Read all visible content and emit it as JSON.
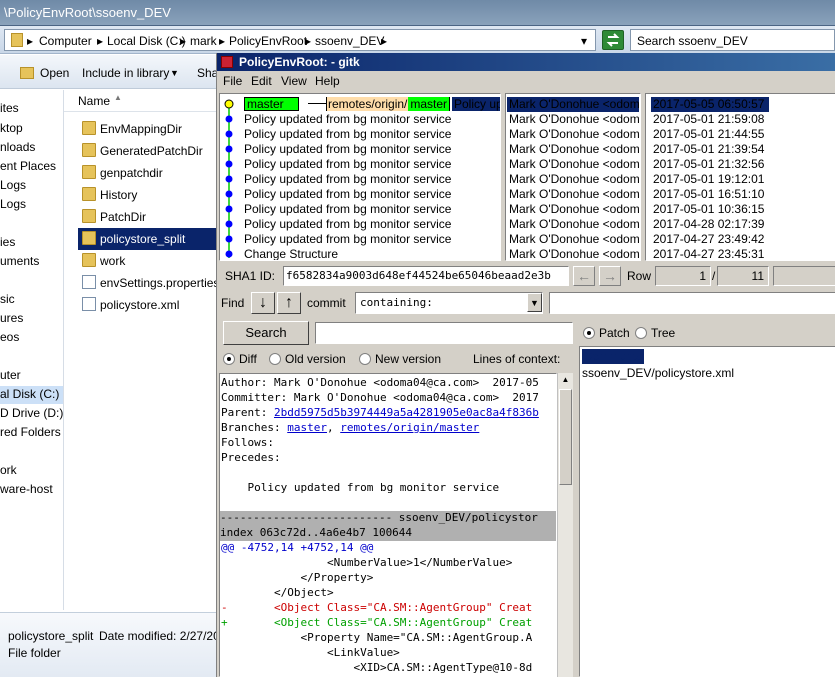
{
  "explorer": {
    "title": "\\PolicyEnvRoot\\ssoenv_DEV",
    "breadcrumbs": [
      "Computer",
      "Local Disk (C:)",
      "mark",
      "PolicyEnvRoot",
      "ssoenv_DEV"
    ],
    "search_placeholder": "Search ssoenv_DEV",
    "toolbar": {
      "open": "Open",
      "include": "Include in library",
      "share": "Sha"
    },
    "nav_items": [
      "ites",
      "ktop",
      "nloads",
      "ent Places",
      "Logs",
      "Logs",
      "ies",
      "uments",
      "sic",
      "ures",
      "eos",
      "uter",
      "al Disk (C:)",
      "D Drive (D:) E",
      "red Folders (",
      "ork",
      "ware-host"
    ],
    "column_name": "Name",
    "files": [
      {
        "name": "EnvMappingDir",
        "type": "folder"
      },
      {
        "name": "GeneratedPatchDir",
        "type": "folder"
      },
      {
        "name": "genpatchdir",
        "type": "folder"
      },
      {
        "name": "History",
        "type": "folder"
      },
      {
        "name": "PatchDir",
        "type": "folder"
      },
      {
        "name": "policystore_split",
        "type": "folder"
      },
      {
        "name": "work",
        "type": "folder"
      },
      {
        "name": "envSettings.properties",
        "type": "file"
      },
      {
        "name": "policystore.xml",
        "type": "file"
      }
    ],
    "details": {
      "name": "policystore_split",
      "modified": "Date modified: 2/27/20",
      "kind": "File folder"
    }
  },
  "gitk": {
    "title": "PolicyEnvRoot: - gitk",
    "menu": [
      "File",
      "Edit",
      "View",
      "Help"
    ],
    "branch_tags": {
      "local": "master",
      "remote_prefix": "remotes/origin/",
      "remote_branch": "master"
    },
    "commits": [
      {
        "msg": "Policy updated from bg monitor service",
        "author": "Mark O'Donohue <odoma",
        "date": "2017-05-05 06:50:57"
      },
      {
        "msg": "Policy updated from bg monitor service",
        "author": "Mark O'Donohue <odom",
        "date": "2017-05-01 21:59:08"
      },
      {
        "msg": "Policy updated from bg monitor service",
        "author": "Mark O'Donohue <odom",
        "date": "2017-05-01 21:44:55"
      },
      {
        "msg": "Policy updated from bg monitor service",
        "author": "Mark O'Donohue <odom",
        "date": "2017-05-01 21:39:54"
      },
      {
        "msg": "Policy updated from bg monitor service",
        "author": "Mark O'Donohue <odom",
        "date": "2017-05-01 21:32:56"
      },
      {
        "msg": "Policy updated from bg monitor service",
        "author": "Mark O'Donohue <odom",
        "date": "2017-05-01 19:12:01"
      },
      {
        "msg": "Policy updated from bg monitor service",
        "author": "Mark O'Donohue <odom",
        "date": "2017-05-01 16:51:10"
      },
      {
        "msg": "Policy updated from bg monitor service",
        "author": "Mark O'Donohue <odom",
        "date": "2017-05-01 10:36:15"
      },
      {
        "msg": "Policy updated from bg monitor service",
        "author": "Mark O'Donohue <odom",
        "date": "2017-04-28 02:17:39"
      },
      {
        "msg": "Policy updated from bg monitor service",
        "author": "Mark O'Donohue <odom",
        "date": "2017-04-27 23:49:42"
      },
      {
        "msg": "Change Structure",
        "author": "Mark O'Donohue <odom",
        "date": "2017-04-27 23:45:31"
      }
    ],
    "first_row_msg_clip": "Policy up",
    "sha": {
      "label": "SHA1 ID:",
      "value": "f6582834a9003d648ef44524be65046beaad2e3b",
      "row_label": "Row",
      "row": "1",
      "of": "/",
      "total": "11"
    },
    "find": {
      "label": "Find",
      "commit_label": "commit",
      "containing": "containing:"
    },
    "search": {
      "button": "Search"
    },
    "view_opts": {
      "patch": "Patch",
      "tree": "Tree",
      "diff": "Diff",
      "old": "Old version",
      "new": "New version",
      "context": "Lines of context:"
    },
    "diff_lines": [
      {
        "text": "Author: Mark O'Donohue <odoma04@ca.com>  2017-05",
        "kind": "plain"
      },
      {
        "text": "Committer: Mark O'Donohue <odoma04@ca.com>  2017",
        "kind": "plain"
      },
      {
        "text": "Parent: ",
        "link": "2bdd5975d5b3974449a5a4281905e0ac8a4f836b",
        "kind": "link"
      },
      {
        "text": "Branches: ",
        "link": "master",
        "link2": "remotes/origin/master",
        "kind": "branches"
      },
      {
        "text": "Follows:",
        "kind": "plain"
      },
      {
        "text": "Precedes:",
        "kind": "plain"
      },
      {
        "text": "",
        "kind": "plain"
      },
      {
        "text": "    Policy updated from bg monitor service",
        "kind": "plain"
      },
      {
        "text": "",
        "kind": "plain"
      },
      {
        "text": "-------------------------- ssoenv_DEV/policystor",
        "kind": "header"
      },
      {
        "text": "index 063c72d..4a6e4b7 100644",
        "kind": "header"
      },
      {
        "text": "@@ -4752,14 +4752,14 @@",
        "kind": "hunk"
      },
      {
        "text": "                <NumberValue>1</NumberValue>",
        "kind": "plain"
      },
      {
        "text": "            </Property>",
        "kind": "plain"
      },
      {
        "text": "        </Object>",
        "kind": "plain"
      },
      {
        "text": "-       <Object Class=\"CA.SM::AgentGroup\" Creat",
        "kind": "del"
      },
      {
        "text": "+       <Object Class=\"CA.SM::AgentGroup\" Creat",
        "kind": "add"
      },
      {
        "text": "            <Property Name=\"CA.SM::AgentGroup.A",
        "kind": "plain"
      },
      {
        "text": "                <LinkValue>",
        "kind": "plain"
      },
      {
        "text": "                    <XID>CA.SM::AgentType@10-8d",
        "kind": "plain"
      }
    ],
    "file_list": [
      "Comments",
      "ssoenv_DEV/policystore.xml"
    ],
    "colors": {
      "branch_local": "#00ff00",
      "branch_remote": "#ffddaa",
      "node": "#0000ff",
      "head_node": "#ffff00",
      "line": "#00cc00",
      "selection": "#0a246a",
      "del": "#cc0000",
      "add": "#00a000",
      "hunk": "#0000cc"
    }
  }
}
